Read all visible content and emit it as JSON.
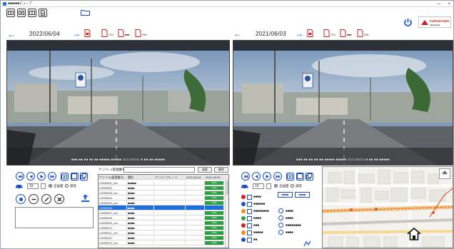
{
  "window": {
    "title": "■■■■■■ビューア",
    "minimize": "—",
    "close": "×"
  },
  "brand": {
    "name": "FURUKAWA",
    "sub": "■■■■■■■■"
  },
  "left": {
    "date": "2022/06/04",
    "icon_labels": [
      "CSV",
      "■■■",
      "KML"
    ],
    "osd": "■■■ ■■ ■■ ■■ ■■ ■■■■■ ■■■■■ 2022/06/04 ■ ■■ ■■ ■■■■■",
    "select_value": "10",
    "radio_labels": [
      "全画面",
      "通常"
    ]
  },
  "right": {
    "date": "2021/06/03",
    "icon_labels": [
      "CSV",
      "■■■",
      "KML"
    ],
    "osd": "■■■ ■■ ■■ ■■ ■■ ■■■■■ ■■■■■ 2021/06/03 ■ ■■ ■■ ■■■■■",
    "select_value": "10",
    "radio_labels": [
      "全画面",
      "通常"
    ],
    "buttons": [
      "■■■■",
      "■■■■"
    ],
    "checklist_left": [
      "■■■■",
      "■■■■■■",
      "■■■■■■■■",
      "■■■■",
      "■■■",
      "■■■■■",
      "■■"
    ],
    "checklist_right": [
      "■■■■",
      "■■■■",
      "■■■■■■■■",
      "■■■■"
    ]
  },
  "search": {
    "label": "ナンバー(管理番号)",
    "value": "",
    "btn_search": "検索",
    "btn_clear": "解除"
  },
  "table": {
    "headers": [
      "ファイル(管理番号)",
      "種別",
      "ナンバープレート",
      "2022-06-04",
      "2021-06-03"
    ],
    "rows": [
      {
        "c1": "L0000001_xxx",
        "c2": "■■■■■",
        "c3": "",
        "c4": "",
        "c5": "",
        "badge": "xxxx",
        "sel": false
      },
      {
        "c1": "L0000002",
        "c2": "■■■■",
        "c3": "",
        "c4": "",
        "c5": "",
        "badge": "xxxx",
        "sel": false
      },
      {
        "c1": "L0000003_xxx",
        "c2": "■■■■",
        "c3": "",
        "c4": "",
        "c5": "",
        "badge": "xxxx",
        "sel": false
      },
      {
        "c1": "L0000004",
        "c2": "■■■■",
        "c3": "",
        "c4": "",
        "c5": "",
        "badge": "xxxx",
        "sel": false
      },
      {
        "c1": "L0000005_xxx",
        "c2": "■■■■",
        "c3": "",
        "c4": "",
        "c5": "",
        "badge": "xxxx",
        "sel": false
      },
      {
        "c1": "L0000006",
        "c2": "■■■■",
        "c3": "",
        "c4": "",
        "c5": "",
        "badge": "",
        "sel": true
      },
      {
        "c1": "L0000007_xxx",
        "c2": "■■■■",
        "c3": "",
        "c4": "",
        "c5": "",
        "badge": "xxxx",
        "sel": false
      },
      {
        "c1": "L0000008",
        "c2": "■■■■",
        "c3": "",
        "c4": "",
        "c5": "",
        "badge": "xxxx",
        "sel": false
      },
      {
        "c1": "L0000009_xxx",
        "c2": "■■■■",
        "c3": "",
        "c4": "",
        "c5": "",
        "badge": "xxxx",
        "sel": false
      },
      {
        "c1": "L0000010",
        "c2": "■■■■",
        "c3": "",
        "c4": "",
        "c5": "",
        "badge": "xxxx",
        "sel": false
      },
      {
        "c1": "L0000011_xxx",
        "c2": "■■■■",
        "c3": "",
        "c4": "",
        "c5": "",
        "badge": "xxxx",
        "sel": false
      },
      {
        "c1": "L0000012",
        "c2": "■■■■",
        "c3": "",
        "c4": "",
        "c5": "",
        "badge": "xxxx",
        "sel": false
      },
      {
        "c1": "L0000013_xxx",
        "c2": "■■■■",
        "c3": "",
        "c4": "",
        "c5": "",
        "badge": "xxxx",
        "sel": false
      }
    ]
  },
  "colors": {
    "accent_blue": "#1f5ed6",
    "red_icon": "#d21f26",
    "badge_green": "#2e9e44",
    "selected_row": "#1f6fd6"
  },
  "icons": [
    "app-icon",
    "camera-front-icon",
    "camera-rear-icon",
    "camera-both-icon",
    "document-icon",
    "folder-icon",
    "power-icon",
    "arrow-left-icon",
    "arrow-right-icon",
    "file-red-icon",
    "csv-icon",
    "print-icon",
    "kml-icon",
    "rewind-icon",
    "step-back-icon",
    "play-icon",
    "step-forward-icon",
    "camera-icon",
    "window-icon",
    "pip-icon",
    "car-icon",
    "record-icon",
    "upload-icon",
    "home-icon",
    "zoom-icon"
  ]
}
